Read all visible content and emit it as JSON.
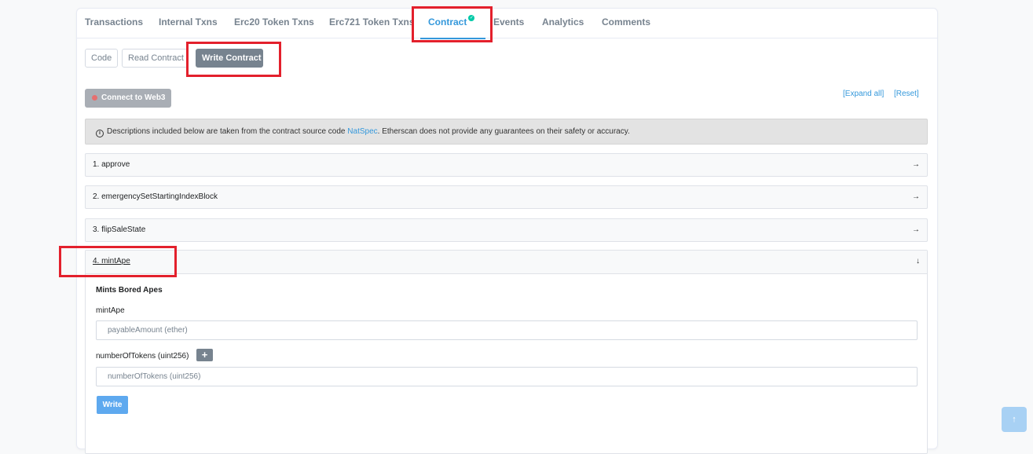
{
  "tabs": [
    {
      "label": "Transactions"
    },
    {
      "label": "Internal Txns"
    },
    {
      "label": "Erc20 Token Txns"
    },
    {
      "label": "Erc721 Token Txns"
    },
    {
      "label": "Contract",
      "active": true,
      "verified_icon": "check-circle-icon"
    },
    {
      "label": "Events"
    },
    {
      "label": "Analytics"
    },
    {
      "label": "Comments"
    }
  ],
  "subtabs": [
    {
      "label": "Code"
    },
    {
      "label": "Read Contract"
    },
    {
      "label": "Write Contract",
      "active": true
    }
  ],
  "connect_button": {
    "label": "Connect to Web3",
    "status_color": "#e66f6f"
  },
  "links": {
    "expand_all": "[Expand all]",
    "reset": "[Reset]"
  },
  "notice": {
    "text_before": "Descriptions included below are taken from the contract source code ",
    "link": "NatSpec",
    "text_after": ". Etherscan does not provide any guarantees on their safety or accuracy."
  },
  "functions": [
    {
      "label": "1. approve",
      "arrow": "→"
    },
    {
      "label": "2. emergencySetStartingIndexBlock",
      "arrow": "→"
    },
    {
      "label": "3. flipSaleState",
      "arrow": "→"
    },
    {
      "label": "4. mintApe",
      "arrow": "↓",
      "expanded": true
    }
  ],
  "mint": {
    "description": "Mints Bored Apes",
    "field1_label": "mintApe",
    "field1_placeholder": "payableAmount (ether)",
    "field2_label": "numberOfTokens (uint256)",
    "field2_placeholder": "numberOfTokens (uint256)",
    "plus": "+",
    "write_label": "Write"
  },
  "colors": {
    "accent": "#3498db",
    "highlight": "#e3202c",
    "write": "#5ea9ef"
  },
  "scroll_top_icon": "↑"
}
